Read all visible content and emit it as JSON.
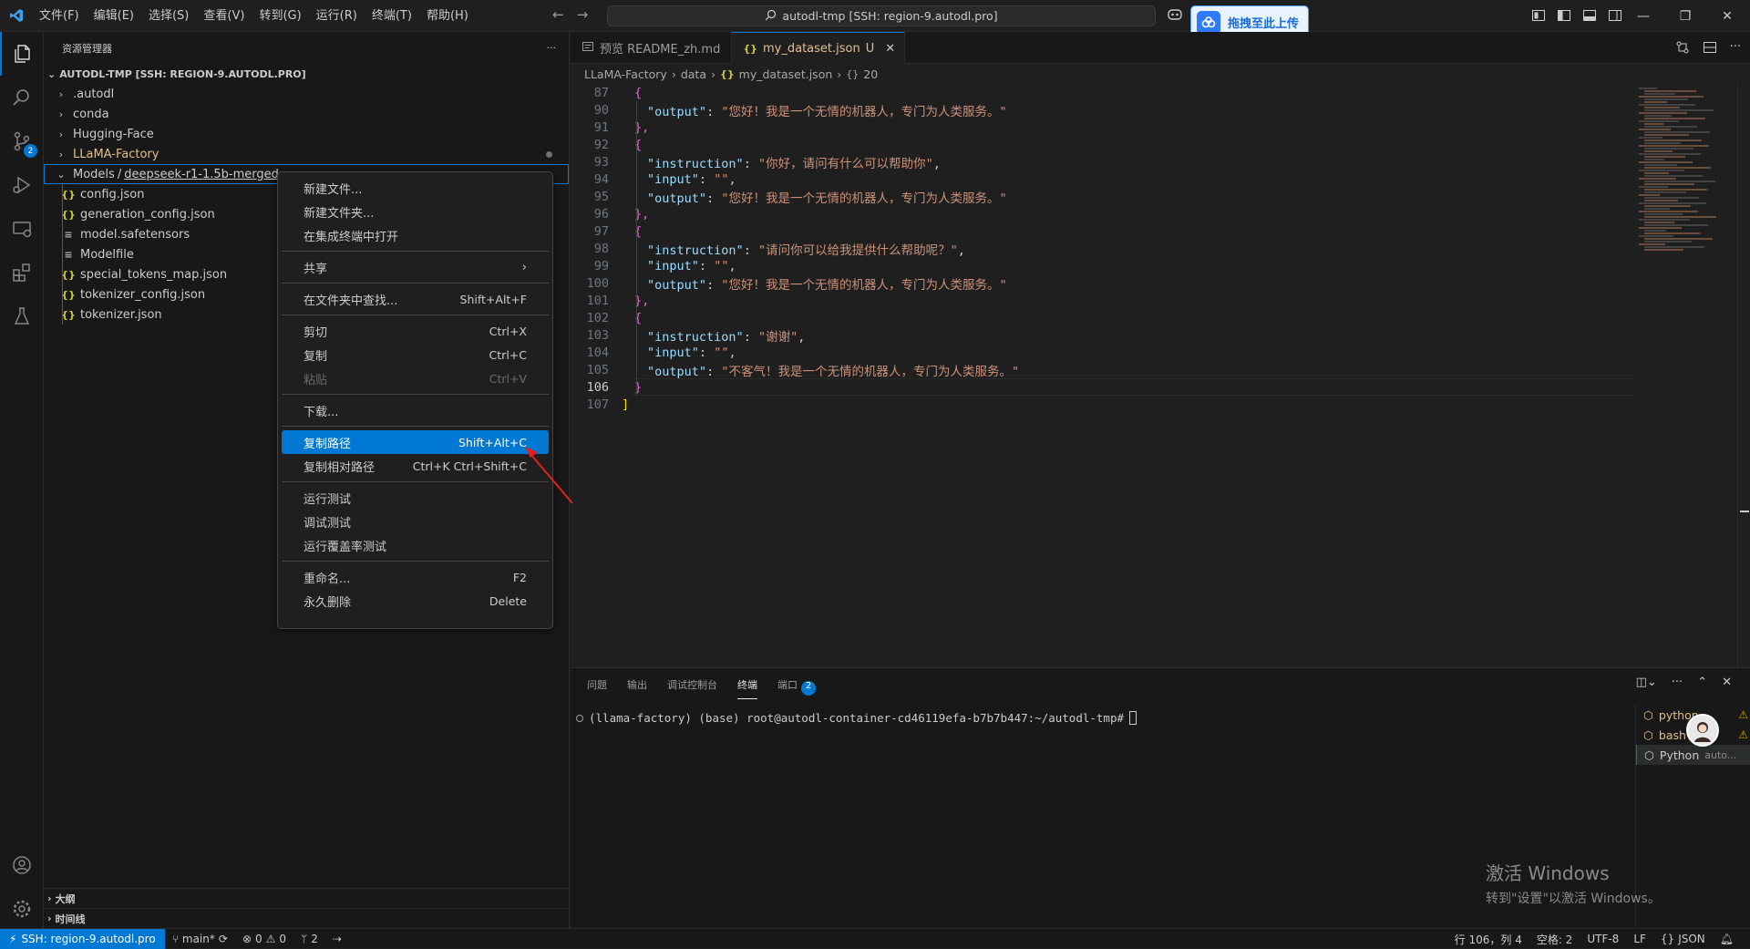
{
  "titlebar": {
    "menus": [
      "文件(F)",
      "编辑(E)",
      "选择(S)",
      "查看(V)",
      "转到(G)",
      "运行(R)",
      "终端(T)",
      "帮助(H)"
    ],
    "command_center": "autodl-tmp [SSH: region-9.autodl.pro]",
    "upload_button": "拖拽至此上传"
  },
  "sidebar": {
    "title": "资源管理器",
    "root": "AUTODL-TMP [SSH: REGION-9.AUTODL.PRO]",
    "folders": [
      ".autodl",
      "conda",
      "Hugging-Face",
      "LLaMA-Factory"
    ],
    "selected_folder": "Models",
    "selected_sep": "/",
    "selected_sub": "deepseek-r1-1.5b-merged",
    "files": [
      {
        "name": "config.json",
        "icon": "json-icon"
      },
      {
        "name": "generation_config.json",
        "icon": "json-icon"
      },
      {
        "name": "model.safetensors",
        "icon": "lines-icon"
      },
      {
        "name": "Modelfile",
        "icon": "lines-icon"
      },
      {
        "name": "special_tokens_map.json",
        "icon": "json-icon"
      },
      {
        "name": "tokenizer_config.json",
        "icon": "json-icon"
      },
      {
        "name": "tokenizer.json",
        "icon": "json-icon"
      }
    ],
    "outline": "大纲",
    "timeline": "时间线"
  },
  "context_menu": {
    "new_file": "新建文件...",
    "new_folder": "新建文件夹...",
    "open_terminal": "在集成终端中打开",
    "share": "共享",
    "find_in_folder": "在文件夹中查找...",
    "find_in_folder_sc": "Shift+Alt+F",
    "cut": "剪切",
    "cut_sc": "Ctrl+X",
    "copy": "复制",
    "copy_sc": "Ctrl+C",
    "paste": "粘贴",
    "paste_sc": "Ctrl+V",
    "download": "下载...",
    "copy_path": "复制路径",
    "copy_path_sc": "Shift+Alt+C",
    "copy_rel_path": "复制相对路径",
    "copy_rel_path_sc": "Ctrl+K Ctrl+Shift+C",
    "run_tests": "运行测试",
    "debug_tests": "调试测试",
    "run_coverage": "运行覆盖率测试",
    "rename": "重命名...",
    "rename_sc": "F2",
    "delete": "永久删除",
    "delete_sc": "Delete"
  },
  "editor": {
    "tabs": [
      {
        "label": "预览 README_zh.md"
      },
      {
        "label": "my_dataset.json",
        "status": "U"
      }
    ],
    "breadcrumb": [
      "LLaMA-Factory",
      "data",
      "my_dataset.json",
      "20"
    ],
    "lines": [
      {
        "n": "87",
        "t": "{"
      },
      {
        "n": "90",
        "key": "output",
        "val": "您好！我是一个无情的机器人，专门为人类服务。"
      },
      {
        "n": "91",
        "t": "},"
      },
      {
        "n": "92",
        "t": "{"
      },
      {
        "n": "93",
        "key": "instruction",
        "val": "你好，请问有什么可以帮助你",
        "comma": true
      },
      {
        "n": "94",
        "key": "input",
        "val": "",
        "comma": true
      },
      {
        "n": "95",
        "key": "output",
        "val": "您好！我是一个无情的机器人，专门为人类服务。"
      },
      {
        "n": "96",
        "t": "},"
      },
      {
        "n": "97",
        "t": "{"
      },
      {
        "n": "98",
        "key": "instruction",
        "val": "请问你可以给我提供什么帮助呢？",
        "comma": true
      },
      {
        "n": "99",
        "key": "input",
        "val": "",
        "comma": true
      },
      {
        "n": "100",
        "key": "output",
        "val": "您好！我是一个无情的机器人，专门为人类服务。"
      },
      {
        "n": "101",
        "t": "},"
      },
      {
        "n": "102",
        "t": "{"
      },
      {
        "n": "103",
        "key": "instruction",
        "val": "谢谢",
        "comma": true
      },
      {
        "n": "104",
        "key": "input",
        "val": "",
        "comma": true
      },
      {
        "n": "105",
        "key": "output",
        "val": "不客气！我是一个无情的机器人，专门为人类服务。"
      },
      {
        "n": "106",
        "t": "}",
        "current": true
      },
      {
        "n": "107",
        "t": "]",
        "outer": true
      }
    ]
  },
  "panel": {
    "tabs": [
      "问题",
      "输出",
      "调试控制台",
      "终端",
      "端口"
    ],
    "active_tab": "终端",
    "ports_count": "2",
    "terminal_line": "(llama-factory) (base) root@autodl-container-cd46119efa-b7b7b447:~/autodl-tmp#",
    "terminals": [
      {
        "name": "python...",
        "warn": true
      },
      {
        "name": "bash",
        "warn": true
      },
      {
        "name": "Python",
        "extra": "auto..."
      }
    ]
  },
  "watermark": {
    "line1": "激活 Windows",
    "line2": "转到\"设置\"以激活 Windows。"
  },
  "statusbar": {
    "remote": "SSH: region-9.autodl.pro",
    "branch": "main*",
    "errors": "0",
    "warnings": "0",
    "ports": "2",
    "position": "行 106，列 4",
    "spaces": "空格: 2",
    "encoding": "UTF-8",
    "eol": "LF",
    "language": "JSON"
  },
  "badges": {
    "source_control": "2"
  },
  "colors": {
    "accent": "#0078d4",
    "json_key": "#9cdcfe",
    "json_string": "#ce9178",
    "modified": "#e2c08d"
  }
}
